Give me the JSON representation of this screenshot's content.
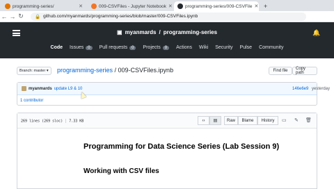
{
  "browser": {
    "tabs": [
      {
        "label": "programming-series/",
        "favicon_color": "#e37400",
        "active": false
      },
      {
        "label": "009-CSVFiles - Jupyter Notebook",
        "favicon_color": "#f37626",
        "active": false
      },
      {
        "label": "programming-series/009-CSVFile",
        "favicon_color": "#24292e",
        "active": true
      }
    ],
    "new_tab": "+",
    "url": "github.com/myanmards/programming-series/blob/master/009-CSVFiles.ipynb"
  },
  "github": {
    "owner": "myanmards",
    "sep": "/",
    "repo": "programming-series",
    "nav": [
      {
        "label": "Code",
        "count": ""
      },
      {
        "label": "Issues",
        "count": "0"
      },
      {
        "label": "Pull requests",
        "count": "0"
      },
      {
        "label": "Projects",
        "count": "0"
      },
      {
        "label": "Actions",
        "count": ""
      },
      {
        "label": "Wiki",
        "count": ""
      },
      {
        "label": "Security",
        "count": ""
      },
      {
        "label": "Pulse",
        "count": ""
      },
      {
        "label": "Community",
        "count": ""
      }
    ]
  },
  "breadcrumb": {
    "branch_label": "Branch: master ▾",
    "repo": "programming-series",
    "file": " / 009-CSVFiles.ipynb",
    "find_file": "Find file",
    "copy_path": "Copy path"
  },
  "commit": {
    "author": "myanmards",
    "message": "update L9 & 10",
    "sha": "146e6e9",
    "when": "yesterday",
    "contributors": "1 contributor"
  },
  "file": {
    "lines": "269 lines (269 sloc)",
    "size": "7.33 KB",
    "raw": "Raw",
    "blame": "Blame",
    "history": "History"
  },
  "notebook": {
    "title": "Programming for Data Science Series (Lab Session 9)",
    "heading": "Working with CSV files"
  },
  "colors": {
    "header": "#24292e",
    "link": "#0366d6",
    "commit_bg": "#f1f8ff"
  }
}
